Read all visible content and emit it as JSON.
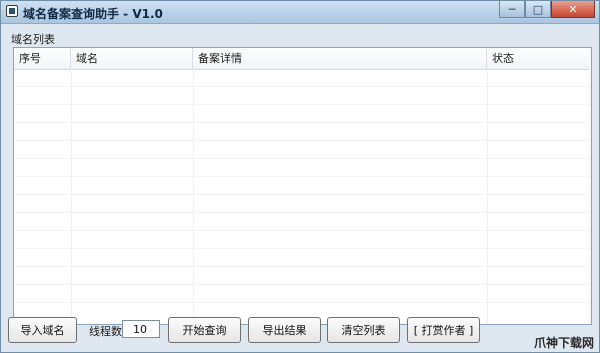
{
  "window": {
    "title": "域名备案查询助手 - V1.0",
    "controls": {
      "minimize": "─",
      "maximize": "□",
      "close": "✕"
    }
  },
  "group": {
    "label": "域名列表",
    "columns": [
      "序号",
      "域名",
      "备案详情",
      "状态"
    ],
    "rows": []
  },
  "toolbar": {
    "import_label": "导入域名",
    "threads_label": "线程数:",
    "threads_value": "10",
    "start_label": "开始查询",
    "export_label": "导出结果",
    "clear_label": "清空列表",
    "donate_label": "[ 打赏作者 ]"
  },
  "watermark": "爪神下载网",
  "colors": {
    "titlebar": "#a9c6e0",
    "window_bg": "#dfe8f1",
    "close_button": "#c9452c"
  },
  "icons": {
    "app": "app-icon"
  }
}
